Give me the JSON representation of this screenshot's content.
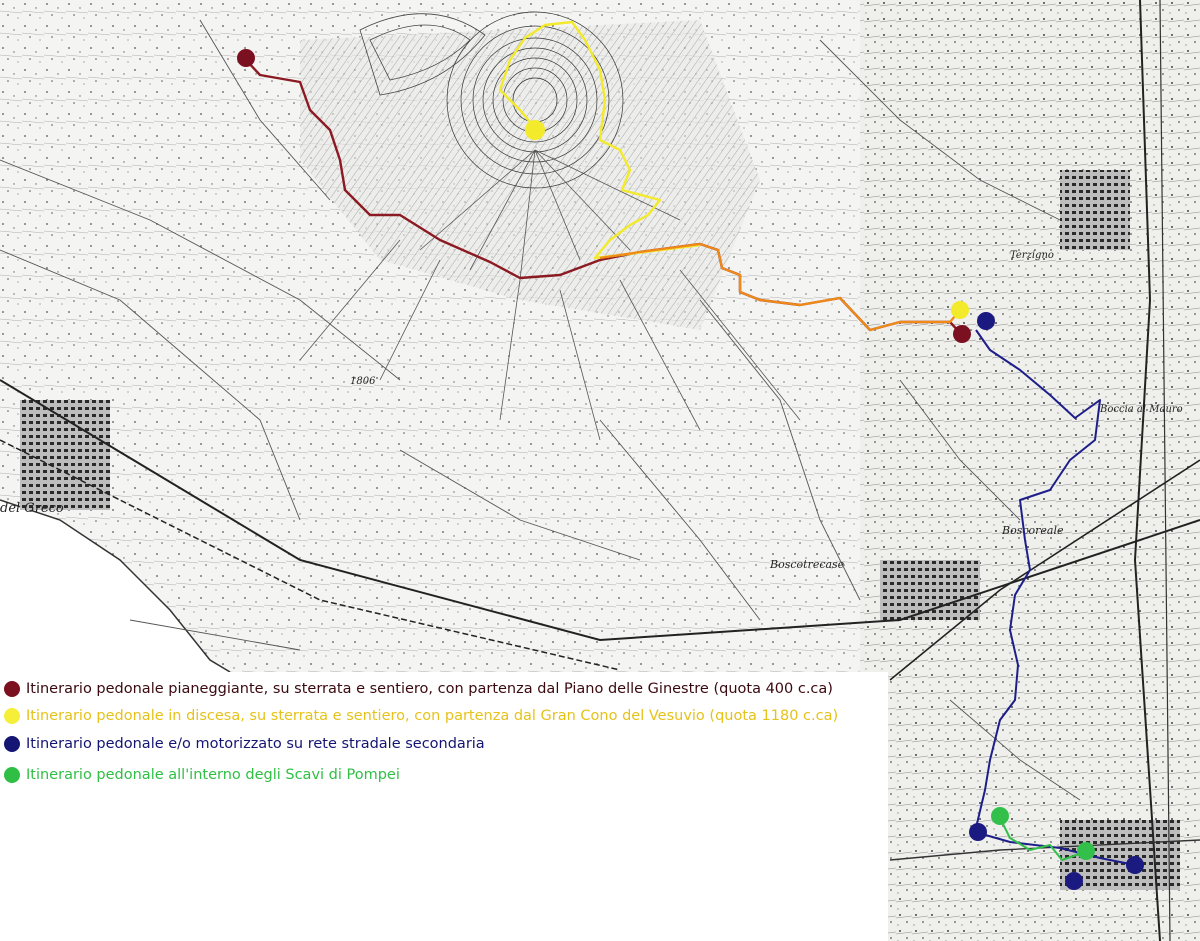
{
  "map": {
    "place_labels": {
      "torre_del_greco": "del Greco",
      "boscoreale": "Boscoreale",
      "boscotrecase": "Boscotrecase",
      "boccia_al_mauro": "Boccia al Mauro",
      "terzigno": "Terzigno",
      "quota_1806": "1806"
    },
    "colors": {
      "dark_red": "#7a1020",
      "yellow": "#f2ea2a",
      "orange": "#ef8a17",
      "navy": "#1a1a80",
      "green": "#33c04a",
      "map_ink": "#2a2a2a"
    },
    "markers": [
      {
        "id": "piano-ginestre-start",
        "color_key": "dark_red"
      },
      {
        "id": "gran-cono-start",
        "color_key": "yellow"
      },
      {
        "id": "junction-yellow",
        "color_key": "yellow"
      },
      {
        "id": "junction-red",
        "color_key": "dark_red"
      },
      {
        "id": "junction-navy",
        "color_key": "navy"
      },
      {
        "id": "pompei-navy-west",
        "color_key": "navy"
      },
      {
        "id": "pompei-green-west",
        "color_key": "green"
      },
      {
        "id": "pompei-green-east",
        "color_key": "green"
      },
      {
        "id": "pompei-navy-south",
        "color_key": "navy"
      },
      {
        "id": "pompei-navy-east",
        "color_key": "navy"
      }
    ]
  },
  "legend": {
    "items": [
      {
        "label": "Itinerario pedonale pianeggiante, su sterrata e sentiero, con partenza dal Piano delle Ginestre (quota 400 c.ca)",
        "color": "#7a1020",
        "text_color": "#3a0a10"
      },
      {
        "label": "Itinerario pedonale in discesa, su sterrata e sentiero, con partenza dal Gran Cono del Vesuvio (quota 1180 c.ca)",
        "color": "#f5ef3a",
        "text_color": "#e6c21a"
      },
      {
        "label": "Itinerario pedonale e/o motorizzato su rete stradale secondaria",
        "color": "#151573",
        "text_color": "#151573"
      },
      {
        "label": "Itinerario pedonale all'interno degli Scavi di Pompei",
        "color": "#2fbf45",
        "text_color": "#2fbf45"
      }
    ]
  }
}
